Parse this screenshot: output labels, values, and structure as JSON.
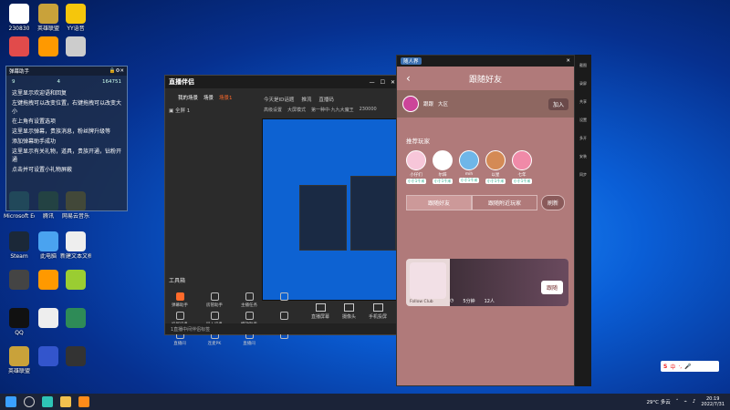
{
  "desktop_icons": [
    {
      "label": "230830",
      "color": "#ffffff"
    },
    {
      "label": "英雄联盟",
      "color": "#c9a23a"
    },
    {
      "label": "YY语音",
      "color": "#f5c60c"
    },
    {
      "label": "",
      "color": "#e14b4b"
    },
    {
      "label": "",
      "color": "#ff9900"
    },
    {
      "label": "",
      "color": "#cccccc"
    },
    {
      "label": "Microsoft Edge",
      "color": "#2ec4b6"
    },
    {
      "label": "腾讯",
      "color": "#3a9e3a"
    },
    {
      "label": "网易云音乐",
      "color": "#e0c000"
    },
    {
      "label": "Steam",
      "color": "#1b2838"
    },
    {
      "label": "此电脑",
      "color": "#4aa3f0"
    },
    {
      "label": "新建文本文档",
      "color": "#eeeeee"
    },
    {
      "label": "",
      "color": "#444444"
    },
    {
      "label": "",
      "color": "#ff9900"
    },
    {
      "label": "",
      "color": "#9acd32"
    },
    {
      "label": "QQ",
      "color": "#111111"
    },
    {
      "label": "",
      "color": "#eeeeee"
    },
    {
      "label": "",
      "color": "#2e8b57"
    },
    {
      "label": "英雄联盟",
      "color": "#c9a23a"
    },
    {
      "label": "",
      "color": "#3355cc"
    },
    {
      "label": "",
      "color": "#333333"
    }
  ],
  "chat": {
    "title": "弹幕助手",
    "stats": [
      "9",
      "4",
      "164751"
    ],
    "messages": [
      "这里显示欢迎语和回复",
      "左键拖拽可以改变位置，右键拖拽可以改变大小",
      "在上角有设置选项",
      "这里显示弹幕，贵族消息，粉丝牌升级等",
      "添加弹幕助手成功",
      "这里显示有关礼物，道具，贵族开通，钻粉开通",
      "点击并可设置小礼物屏蔽"
    ]
  },
  "stream_app": {
    "logo": "直播伴侣",
    "tabs": [
      "我的场景",
      "场景",
      "场景1"
    ],
    "right_tabs": [
      "今天是ID话题",
      "推流",
      "直播码"
    ],
    "sub_items": [
      "高级设置",
      "大屏模式",
      "第一种中·九九大魔王",
      "230000"
    ],
    "scene_label": "全屏 1",
    "tools_title": "工具箱",
    "tools": [
      {
        "label": "弹幕助手",
        "hot": true
      },
      {
        "label": "房管助手",
        "hot": false
      },
      {
        "label": "主播任务",
        "hot": false
      },
      {
        "label": "",
        "hot": false
      },
      {
        "label": "投屏设备",
        "hot": false
      },
      {
        "label": "导入设备",
        "hot": false
      },
      {
        "label": "特效助手",
        "hot": false
      },
      {
        "label": "",
        "hot": false
      },
      {
        "label": "直播间",
        "hot": false
      },
      {
        "label": "连麦PK",
        "hot": false
      },
      {
        "label": "直播间",
        "hot": false
      },
      {
        "label": "",
        "hot": false
      }
    ],
    "actions": [
      "直播屏幕",
      "摄像头",
      "手机投屏"
    ],
    "status": "1直播中间伴侣标签"
  },
  "phone": {
    "title": "随人界",
    "header": "跟随好友",
    "room": {
      "name": "跟跟",
      "tag": "大区",
      "join_label": "加入"
    },
    "recommend_title": "推荐玩家",
    "players": [
      {
        "name": "小仔们",
        "badge": "小于1千米",
        "color": "#f7c6d9"
      },
      {
        "name": "尔辞",
        "badge": "小于1千米",
        "color": "#ffffff"
      },
      {
        "name": "mih",
        "badge": "小于1千米",
        "color": "#6fb6e8"
      },
      {
        "name": "以星",
        "badge": "小于1千米",
        "color": "#d48a55"
      },
      {
        "name": "七年",
        "badge": "小于1千米",
        "color": "#f08aa8"
      }
    ],
    "segments": [
      "跟随好友",
      "跟随附近玩家"
    ],
    "refresh_label": "刷新",
    "card": {
      "user": "Follow Club",
      "time": "5分钟",
      "count": "12人"
    }
  },
  "emulator_side": [
    "截图",
    "录屏",
    "共享",
    "设置",
    "多开",
    "安装",
    "同步"
  ],
  "taskbar": {
    "weather": "29°C 多云",
    "time": "20:19",
    "date": "2022/7/31"
  },
  "ime": {
    "label": "中"
  }
}
